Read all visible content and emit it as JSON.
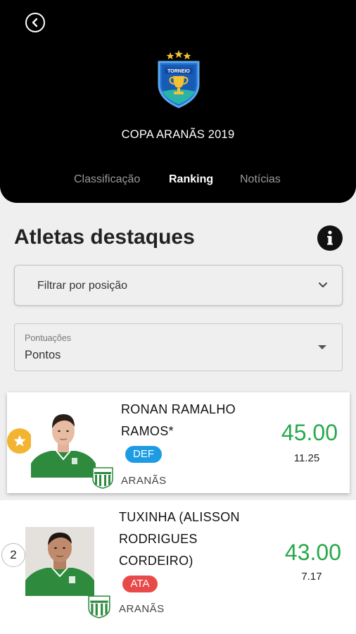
{
  "header": {
    "title": "COPA ARANÃS 2019",
    "logo_text": "TORNEIO",
    "tabs": [
      {
        "label": "Classificação",
        "active": false
      },
      {
        "label": "Ranking",
        "active": true
      },
      {
        "label": "Notícias",
        "active": false
      }
    ]
  },
  "section": {
    "title": "Atletas destaques",
    "info_icon": "info-icon"
  },
  "filters": {
    "position_filter": {
      "label": "Filtrar por posição"
    },
    "score_select": {
      "label": "Pontuações",
      "value": "Pontos"
    }
  },
  "athletes": [
    {
      "rank_icon": "star-icon",
      "name": "RONAN RAMALHO RAMOS*",
      "position": "DEF",
      "team": "ARANÃS",
      "points": "45.00",
      "average": "11.25"
    },
    {
      "rank": "2",
      "name": "TUXINHA (ALISSON RODRIGUES CORDEIRO)",
      "position": "ATA",
      "team": "ARANÃS",
      "points": "43.00",
      "average": "7.17"
    }
  ],
  "colors": {
    "header_bg": "#000000",
    "points": "#27a94a",
    "def_badge": "#1d9ce3",
    "ata_badge": "#e84a4a",
    "rank_star": "#f2b431"
  }
}
